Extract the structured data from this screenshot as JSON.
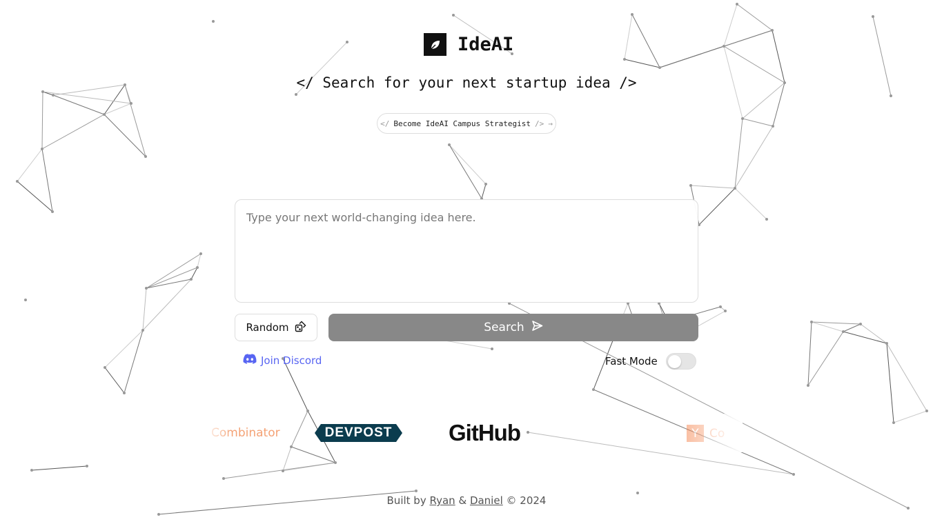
{
  "app": {
    "name": "IdeAI",
    "logo_icon": "leaf-icon"
  },
  "tagline": "</ Search for your next startup idea />",
  "promo": {
    "prefix": "</",
    "label": "Become IdeAI Campus Strategist",
    "suffix": "/>",
    "arrow": "→"
  },
  "idea_input": {
    "value": "",
    "placeholder": "Type your next world-changing idea here."
  },
  "buttons": {
    "random_label": "Random",
    "random_icon": "dice-icon",
    "search_label": "Search",
    "search_icon": "send-icon"
  },
  "discord": {
    "label": "Join Discord",
    "icon": "discord-icon"
  },
  "fast_mode": {
    "label": "Fast Mode",
    "enabled": false
  },
  "sponsors": {
    "yc_partial": "Combinator",
    "devpost": "DEVPOST",
    "github": "GitHub",
    "yc_letter": "Y",
    "yc_text_partial": "Co"
  },
  "footer": {
    "prefix": "Built by",
    "author1": "Ryan",
    "amp": "&",
    "author2": "Daniel",
    "suffix": "© 2024"
  },
  "colors": {
    "search_bg": "#888888",
    "discord": "#5865f2",
    "devpost_bg": "#0b3c4e",
    "yc_orange": "#f26522"
  }
}
